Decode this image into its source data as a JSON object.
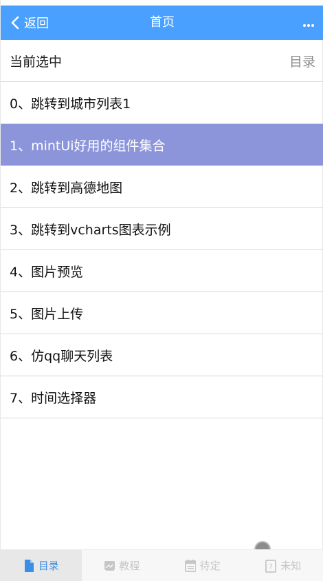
{
  "navbar": {
    "back_label": "返回",
    "title": "首页",
    "more_icon": "more-icon"
  },
  "header": {
    "current_label": "当前选中",
    "catalog_label": "目录"
  },
  "list": [
    {
      "label": "0、跳转到城市列表1",
      "active": false
    },
    {
      "label": "1、mintUi好用的组件集合",
      "active": true
    },
    {
      "label": "2、跳转到高德地图",
      "active": false
    },
    {
      "label": "3、跳转到vcharts图表示例",
      "active": false
    },
    {
      "label": "4、图片预览",
      "active": false
    },
    {
      "label": "5、图片上传",
      "active": false
    },
    {
      "label": "6、仿qq聊天列表",
      "active": false
    },
    {
      "label": "7、时间选择器",
      "active": false
    }
  ],
  "tabbar": {
    "items": [
      {
        "label": "目录",
        "icon": "document-icon",
        "active": true
      },
      {
        "label": "教程",
        "icon": "image-icon",
        "active": false
      },
      {
        "label": "待定",
        "icon": "calendar-icon",
        "active": false
      },
      {
        "label": "未知",
        "icon": "question-icon",
        "active": false
      }
    ]
  },
  "colors": {
    "navbar_bg": "#4aa0ff",
    "active_item_bg": "#8d95da",
    "tab_active_text": "#3a8ee6"
  }
}
